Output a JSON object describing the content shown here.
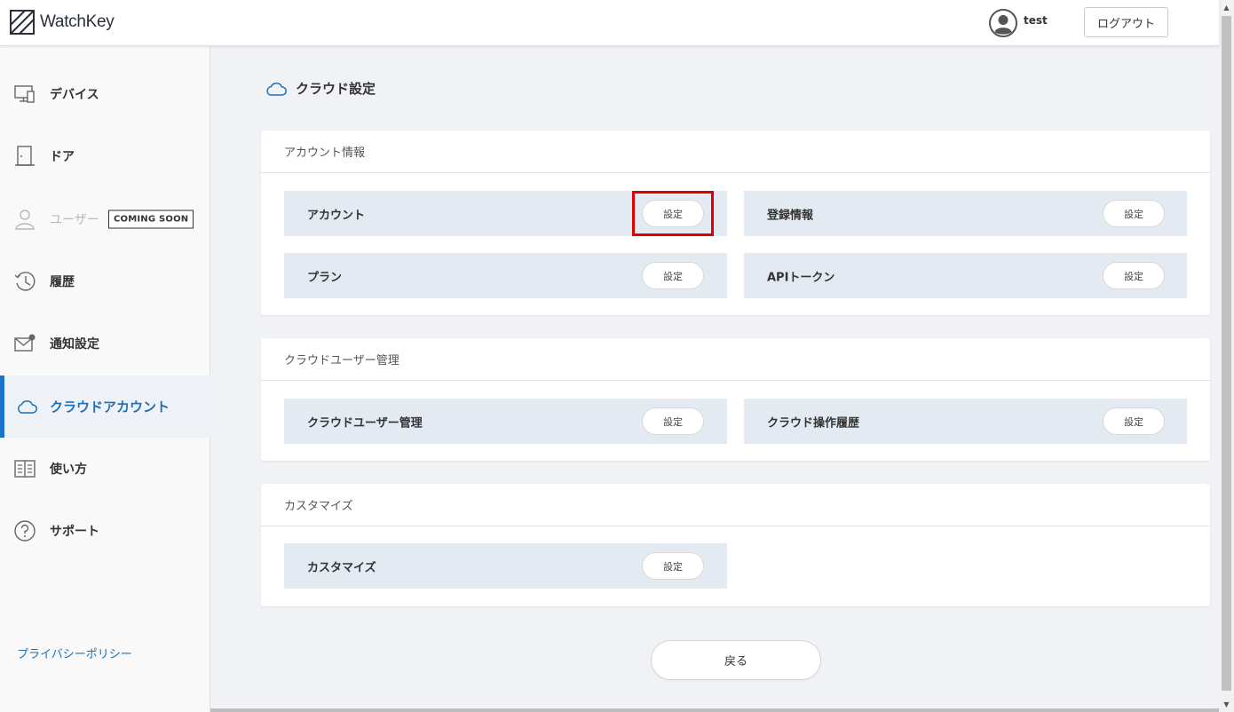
{
  "header": {
    "logo_text": "WatchKey",
    "user_name": "test",
    "logout_label": "ログアウト"
  },
  "sidebar": {
    "items": [
      {
        "label": "デバイス",
        "icon": "device-icon"
      },
      {
        "label": "ドア",
        "icon": "door-icon"
      },
      {
        "label": "ユーザー",
        "icon": "user-icon",
        "badge": "COMING SOON"
      },
      {
        "label": "履歴",
        "icon": "history-icon"
      },
      {
        "label": "通知設定",
        "icon": "mail-icon"
      },
      {
        "label": "クラウドアカウント",
        "icon": "cloud-icon"
      },
      {
        "label": "使い方",
        "icon": "book-icon"
      },
      {
        "label": "サポート",
        "icon": "help-icon"
      }
    ],
    "privacy_label": "プライバシーポリシー"
  },
  "main": {
    "title": "クラウド設定",
    "sections": [
      {
        "header": "アカウント情報",
        "items": [
          {
            "label": "アカウント",
            "button": "設定"
          },
          {
            "label": "登録情報",
            "button": "設定"
          },
          {
            "label": "プラン",
            "button": "設定"
          },
          {
            "label": "APIトークン",
            "button": "設定"
          }
        ]
      },
      {
        "header": "クラウドユーザー管理",
        "items": [
          {
            "label": "クラウドユーザー管理",
            "button": "設定"
          },
          {
            "label": "クラウド操作履歴",
            "button": "設定"
          }
        ]
      },
      {
        "header": "カスタマイズ",
        "items": [
          {
            "label": "カスタマイズ",
            "button": "設定"
          }
        ]
      }
    ],
    "back_label": "戻る"
  },
  "colors": {
    "accent": "#1f6fb5",
    "active_bar": "#1a73c8",
    "row_background": "#e4eaf2",
    "highlight": "#e00000"
  }
}
